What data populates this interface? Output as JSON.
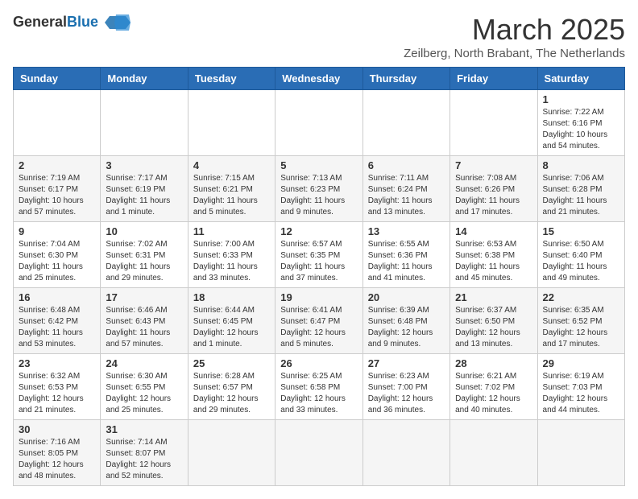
{
  "logo": {
    "line1": "General",
    "line2": "Blue"
  },
  "title": "March 2025",
  "subtitle": "Zeilberg, North Brabant, The Netherlands",
  "weekdays": [
    "Sunday",
    "Monday",
    "Tuesday",
    "Wednesday",
    "Thursday",
    "Friday",
    "Saturday"
  ],
  "weeks": [
    [
      {
        "day": "",
        "info": ""
      },
      {
        "day": "",
        "info": ""
      },
      {
        "day": "",
        "info": ""
      },
      {
        "day": "",
        "info": ""
      },
      {
        "day": "",
        "info": ""
      },
      {
        "day": "",
        "info": ""
      },
      {
        "day": "1",
        "info": "Sunrise: 7:22 AM\nSunset: 6:16 PM\nDaylight: 10 hours and 54 minutes."
      }
    ],
    [
      {
        "day": "2",
        "info": "Sunrise: 7:19 AM\nSunset: 6:17 PM\nDaylight: 10 hours and 57 minutes."
      },
      {
        "day": "3",
        "info": "Sunrise: 7:17 AM\nSunset: 6:19 PM\nDaylight: 11 hours and 1 minute."
      },
      {
        "day": "4",
        "info": "Sunrise: 7:15 AM\nSunset: 6:21 PM\nDaylight: 11 hours and 5 minutes."
      },
      {
        "day": "5",
        "info": "Sunrise: 7:13 AM\nSunset: 6:23 PM\nDaylight: 11 hours and 9 minutes."
      },
      {
        "day": "6",
        "info": "Sunrise: 7:11 AM\nSunset: 6:24 PM\nDaylight: 11 hours and 13 minutes."
      },
      {
        "day": "7",
        "info": "Sunrise: 7:08 AM\nSunset: 6:26 PM\nDaylight: 11 hours and 17 minutes."
      },
      {
        "day": "8",
        "info": "Sunrise: 7:06 AM\nSunset: 6:28 PM\nDaylight: 11 hours and 21 minutes."
      }
    ],
    [
      {
        "day": "9",
        "info": "Sunrise: 7:04 AM\nSunset: 6:30 PM\nDaylight: 11 hours and 25 minutes."
      },
      {
        "day": "10",
        "info": "Sunrise: 7:02 AM\nSunset: 6:31 PM\nDaylight: 11 hours and 29 minutes."
      },
      {
        "day": "11",
        "info": "Sunrise: 7:00 AM\nSunset: 6:33 PM\nDaylight: 11 hours and 33 minutes."
      },
      {
        "day": "12",
        "info": "Sunrise: 6:57 AM\nSunset: 6:35 PM\nDaylight: 11 hours and 37 minutes."
      },
      {
        "day": "13",
        "info": "Sunrise: 6:55 AM\nSunset: 6:36 PM\nDaylight: 11 hours and 41 minutes."
      },
      {
        "day": "14",
        "info": "Sunrise: 6:53 AM\nSunset: 6:38 PM\nDaylight: 11 hours and 45 minutes."
      },
      {
        "day": "15",
        "info": "Sunrise: 6:50 AM\nSunset: 6:40 PM\nDaylight: 11 hours and 49 minutes."
      }
    ],
    [
      {
        "day": "16",
        "info": "Sunrise: 6:48 AM\nSunset: 6:42 PM\nDaylight: 11 hours and 53 minutes."
      },
      {
        "day": "17",
        "info": "Sunrise: 6:46 AM\nSunset: 6:43 PM\nDaylight: 11 hours and 57 minutes."
      },
      {
        "day": "18",
        "info": "Sunrise: 6:44 AM\nSunset: 6:45 PM\nDaylight: 12 hours and 1 minute."
      },
      {
        "day": "19",
        "info": "Sunrise: 6:41 AM\nSunset: 6:47 PM\nDaylight: 12 hours and 5 minutes."
      },
      {
        "day": "20",
        "info": "Sunrise: 6:39 AM\nSunset: 6:48 PM\nDaylight: 12 hours and 9 minutes."
      },
      {
        "day": "21",
        "info": "Sunrise: 6:37 AM\nSunset: 6:50 PM\nDaylight: 12 hours and 13 minutes."
      },
      {
        "day": "22",
        "info": "Sunrise: 6:35 AM\nSunset: 6:52 PM\nDaylight: 12 hours and 17 minutes."
      }
    ],
    [
      {
        "day": "23",
        "info": "Sunrise: 6:32 AM\nSunset: 6:53 PM\nDaylight: 12 hours and 21 minutes."
      },
      {
        "day": "24",
        "info": "Sunrise: 6:30 AM\nSunset: 6:55 PM\nDaylight: 12 hours and 25 minutes."
      },
      {
        "day": "25",
        "info": "Sunrise: 6:28 AM\nSunset: 6:57 PM\nDaylight: 12 hours and 29 minutes."
      },
      {
        "day": "26",
        "info": "Sunrise: 6:25 AM\nSunset: 6:58 PM\nDaylight: 12 hours and 33 minutes."
      },
      {
        "day": "27",
        "info": "Sunrise: 6:23 AM\nSunset: 7:00 PM\nDaylight: 12 hours and 36 minutes."
      },
      {
        "day": "28",
        "info": "Sunrise: 6:21 AM\nSunset: 7:02 PM\nDaylight: 12 hours and 40 minutes."
      },
      {
        "day": "29",
        "info": "Sunrise: 6:19 AM\nSunset: 7:03 PM\nDaylight: 12 hours and 44 minutes."
      }
    ],
    [
      {
        "day": "30",
        "info": "Sunrise: 7:16 AM\nSunset: 8:05 PM\nDaylight: 12 hours and 48 minutes."
      },
      {
        "day": "31",
        "info": "Sunrise: 7:14 AM\nSunset: 8:07 PM\nDaylight: 12 hours and 52 minutes."
      },
      {
        "day": "",
        "info": ""
      },
      {
        "day": "",
        "info": ""
      },
      {
        "day": "",
        "info": ""
      },
      {
        "day": "",
        "info": ""
      },
      {
        "day": "",
        "info": ""
      }
    ]
  ]
}
